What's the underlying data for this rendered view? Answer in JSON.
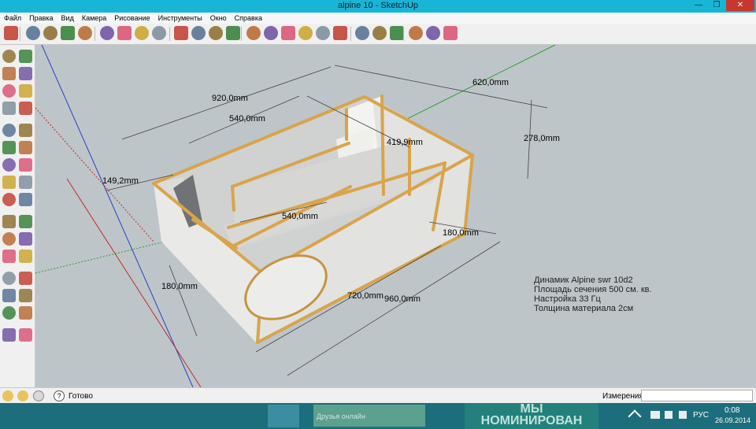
{
  "window": {
    "title": "alpine 10 - SketchUp",
    "min_icon": "minimize-icon",
    "max_icon": "maximize-icon",
    "close_icon": "close-icon",
    "min_glyph": "—",
    "max_glyph": "❐",
    "close_glyph": "✕"
  },
  "menu": [
    "Файл",
    "Правка",
    "Вид",
    "Камера",
    "Рисование",
    "Инструменты",
    "Окно",
    "Справка"
  ],
  "toolbar_icons": [
    "select-icon",
    "pencil-icon",
    "rectangle-icon",
    "circle-icon",
    "arc-icon",
    "make-component-icon",
    "eraser-icon",
    "tape-measure-icon",
    "paint-bucket-icon",
    "push-pull-icon",
    "move-icon",
    "rotate-icon",
    "follow-me-icon",
    "orbit-icon",
    "pan-icon",
    "zoom-icon",
    "zoom-extents-icon",
    "previous-view-icon",
    "next-view-icon",
    "3d-warehouse-icon",
    "share-model-icon",
    "get-models-icon",
    "components-icon",
    "extension-warehouse-icon",
    "layout-icon"
  ],
  "palette_icons": [
    "select-icon",
    "make-component-icon",
    "paint-bucket-icon",
    "eraser-icon",
    "rectangle-icon",
    "line-icon",
    "circle-icon",
    "arc-icon",
    "polygon-icon",
    "freehand-icon",
    "move-icon",
    "push-pull-icon",
    "rotate-icon",
    "follow-me-icon",
    "scale-icon",
    "offset-icon",
    "tape-measure-icon",
    "dimension-icon",
    "protractor-icon",
    "text-icon",
    "axes-icon",
    "3d-text-icon",
    "orbit-icon",
    "pan-icon",
    "zoom-icon",
    "zoom-window-icon",
    "zoom-extents-icon",
    "previous-icon",
    "section-plane-icon",
    "look-around-icon",
    "walk-icon",
    "position-camera-icon"
  ],
  "dimensions": {
    "top_length": "920,0mm",
    "depth": "620,0mm",
    "inner_length": "540,0mm",
    "partition": "419,9mm",
    "height": "278,0mm",
    "port_width": "149,2mm",
    "inner_port": "540,0mm",
    "right_port": "180,0mm",
    "left_height": "180,0mm",
    "front_inner": "720,0mm",
    "front_length": "960,0mm"
  },
  "notes": [
    "Динамик Alpine swr 10d2",
    "Площадь сечения 500 см. кв.",
    "Настройка 33 Гц",
    "Толщина материала 2см"
  ],
  "status": {
    "text": "Готово",
    "measure_label": "Измерения",
    "measure_value": ""
  },
  "taskbar": {
    "news": "Друзья онлайн",
    "promo_line1": "МЫ",
    "promo_line2": "НОМИНИРОВАН",
    "lang": "РУС",
    "time": "0:08",
    "date": "26.09.2014"
  },
  "colors": {
    "titlebar": "#19b5d6",
    "viewport": "#bdc5c9",
    "wood": "#d9a44a",
    "panel": "#e8e8e6",
    "taskbar": "#1d6e7c"
  }
}
